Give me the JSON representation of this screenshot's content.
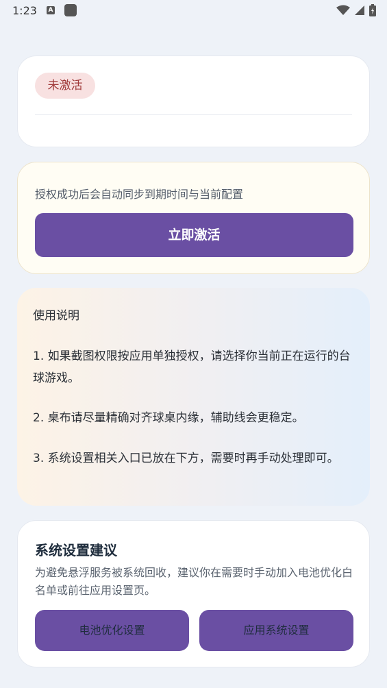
{
  "status_bar": {
    "time": "1:23",
    "notif_letter": "A",
    "icons": [
      "wifi-icon",
      "signal-icon",
      "battery-icon"
    ]
  },
  "status_card": {
    "badge": "未激活"
  },
  "activate_card": {
    "hint": "授权成功后会自动同步到期时间与当前配置",
    "button": "立即激活"
  },
  "guide": {
    "title": "使用说明",
    "items": [
      "1. 如果截图权限按应用单独授权，请选择你当前正在运行的台球游戏。",
      "2. 桌布请尽量精确对齐球桌内缘，辅助线会更稳定。",
      "3. 系统设置相关入口已放在下方，需要时再手动处理即可。"
    ]
  },
  "settings": {
    "title": "系统设置建议",
    "description": "为避免悬浮服务被系统回收，建议你在需要时手动加入电池优化白名单或前往应用设置页。",
    "battery_button": "电池优化设置",
    "app_button": "应用系统设置"
  },
  "colors": {
    "primary": "#6a4fa3",
    "badge_bg": "#f8e1e1",
    "badge_text": "#a03a3a",
    "background": "#eef2f8"
  }
}
